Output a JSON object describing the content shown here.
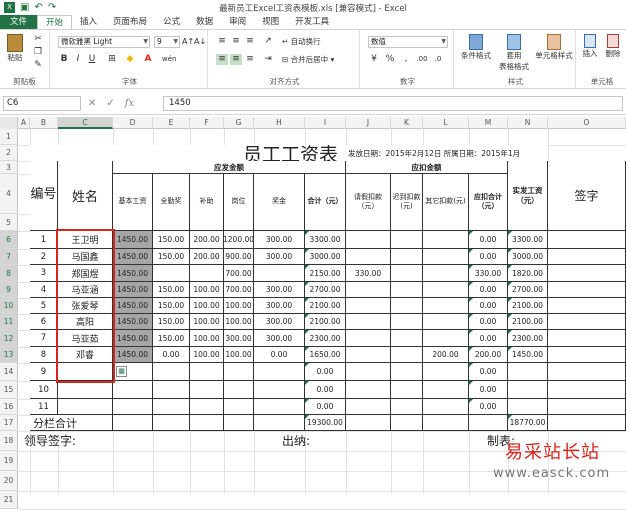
{
  "title": "最新员工Excel工资表模板.xls [兼容模式] - Excel",
  "tabs": [
    {
      "label": "文件"
    },
    {
      "label": "开始"
    },
    {
      "label": "插入"
    },
    {
      "label": "页面布局"
    },
    {
      "label": "公式"
    },
    {
      "label": "数据"
    },
    {
      "label": "审阅"
    },
    {
      "label": "视图"
    },
    {
      "label": "开发工具"
    }
  ],
  "ribbon": {
    "paste": "粘贴",
    "clipboard": "剪贴板",
    "font_name": "微软雅黑 Light",
    "font_size": "9",
    "font_group": "字体",
    "wrap_text": "自动换行",
    "merge_center": "合并后居中",
    "align_group": "对齐方式",
    "number_format": "数值",
    "number_group": "数字",
    "cond_format": "条件格式",
    "table_format": "套用\n表格格式",
    "cell_style": "单元格样式",
    "style_group": "样式",
    "insert": "插入",
    "delete": "删除",
    "cells_group": "单元格"
  },
  "formula_bar": {
    "name_box": "C6",
    "value": "1450"
  },
  "columns": [
    "A",
    "B",
    "C",
    "D",
    "E",
    "F",
    "G",
    "H",
    "I",
    "J",
    "K",
    "L",
    "M",
    "N",
    "O"
  ],
  "rows": [
    "1",
    "2",
    "3",
    "4",
    "5",
    "6",
    "7",
    "8",
    "9",
    "10",
    "11",
    "12",
    "13",
    "14",
    "15",
    "16",
    "17",
    "18",
    "19",
    "20",
    "21"
  ],
  "sheet": {
    "title": "员工工资表",
    "issue_date": "发放日期：2015年2月12日 所属日期：2015年1月",
    "no_header": "编号",
    "name_header": "姓名",
    "pay_group": "应发金额",
    "deduct_group": "应扣金额",
    "net_header": "实发工资（元）",
    "sign_header": "签字",
    "sub_headers": [
      "基本工资",
      "全勤奖",
      "补助",
      "岗位",
      "奖金",
      "合计（元）",
      "请假扣款（元）",
      "迟到扣款(元)",
      "其它扣款(元)",
      "应扣合计（元）"
    ],
    "rows": [
      [
        "1",
        "王卫明",
        "1450.00",
        "150.00",
        "200.00",
        "1200.00",
        "300.00",
        "3300.00",
        "",
        "",
        "",
        "0.00",
        "3300.00"
      ],
      [
        "2",
        "马国鑫",
        "1450.00",
        "150.00",
        "200.00",
        "900.00",
        "300.00",
        "3000.00",
        "",
        "",
        "",
        "0.00",
        "3000.00"
      ],
      [
        "3",
        "郑国煜",
        "1450.00",
        "",
        "",
        "700.00",
        "",
        "2150.00",
        "330.00",
        "",
        "",
        "330.00",
        "1820.00"
      ],
      [
        "4",
        "马亚涵",
        "1450.00",
        "150.00",
        "100.00",
        "700.00",
        "300.00",
        "2700.00",
        "",
        "",
        "",
        "0.00",
        "2700.00"
      ],
      [
        "5",
        "张爱琴",
        "1450.00",
        "150.00",
        "100.00",
        "100.00",
        "300.00",
        "2100.00",
        "",
        "",
        "",
        "0.00",
        "2100.00"
      ],
      [
        "6",
        "高阳",
        "1450.00",
        "150.00",
        "100.00",
        "100.00",
        "300.00",
        "2100.00",
        "",
        "",
        "",
        "0.00",
        "2100.00"
      ],
      [
        "7",
        "马亚茹",
        "1450.00",
        "150.00",
        "100.00",
        "300.00",
        "300.00",
        "2300.00",
        "",
        "",
        "",
        "0.00",
        "2300.00"
      ],
      [
        "8",
        "邓睿",
        "1450.00",
        "0.00",
        "100.00",
        "100.00",
        "0.00",
        "1650.00",
        "",
        "",
        "200.00",
        "200.00",
        "1450.00"
      ],
      [
        "9",
        "",
        "",
        "",
        "",
        "",
        "",
        "0.00",
        "",
        "",
        "",
        "0.00",
        ""
      ],
      [
        "10",
        "",
        "",
        "",
        "",
        "",
        "",
        "0.00",
        "",
        "",
        "",
        "0.00",
        ""
      ],
      [
        "11",
        "",
        "",
        "",
        "",
        "",
        "",
        "0.00",
        "",
        "",
        "",
        "0.00",
        ""
      ]
    ],
    "total_label": "分栏合计",
    "total_sum": "19300.00",
    "total_net": "18770.00",
    "footer_leader": "领导签字:",
    "footer_cashier": "出纳:",
    "footer_maker": "制表:"
  },
  "watermark": "易采站长站",
  "watermark_url": "www.easck.com",
  "accent_color": "#217346",
  "highlight_color": "#d9241b"
}
